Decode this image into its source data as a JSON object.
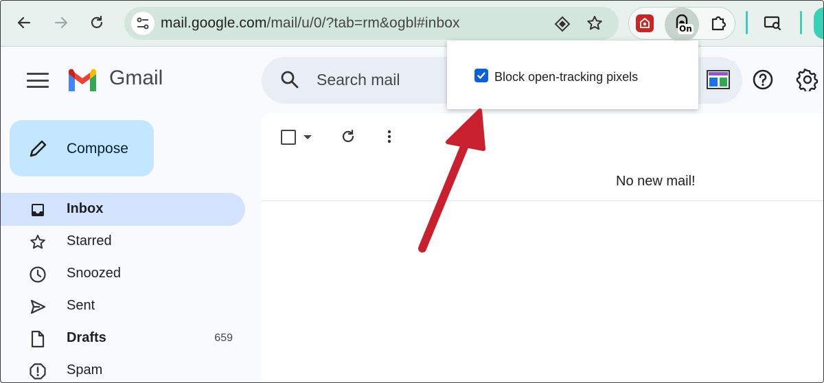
{
  "browser": {
    "url_host": "mail.google.com",
    "url_path": "/mail/u/0/?tab=rm&ogbl#inbox",
    "extension_badge": "On",
    "icons": [
      "back-icon",
      "forward-icon",
      "reload-icon",
      "site-settings-icon",
      "send-to-devices-icon",
      "bookmark-star-icon",
      "extension-red-icon",
      "tracking-extension-icon",
      "puzzle-extensions-icon",
      "cast-icon"
    ]
  },
  "gmail": {
    "app_name": "Gmail",
    "search_placeholder": "Search mail",
    "compose_label": "Compose",
    "nav": [
      {
        "label": "Inbox",
        "bold": true,
        "active": true,
        "icon": "inbox-icon",
        "count": ""
      },
      {
        "label": "Starred",
        "bold": false,
        "active": false,
        "icon": "star-icon",
        "count": ""
      },
      {
        "label": "Snoozed",
        "bold": false,
        "active": false,
        "icon": "clock-icon",
        "count": ""
      },
      {
        "label": "Sent",
        "bold": false,
        "active": false,
        "icon": "send-icon",
        "count": ""
      },
      {
        "label": "Drafts",
        "bold": true,
        "active": false,
        "icon": "draft-icon",
        "count": "659"
      },
      {
        "label": "Spam",
        "bold": false,
        "active": false,
        "icon": "spam-icon",
        "count": ""
      }
    ],
    "empty_message": "No new mail!"
  },
  "popup": {
    "checkbox_label": "Block open-tracking pixels",
    "checked": true
  },
  "colors": {
    "compose_bg": "#c2e7ff",
    "active_nav_bg": "#d3e3fd",
    "annotation_arrow": "#c8202e",
    "checkbox_blue": "#0b62d6"
  }
}
